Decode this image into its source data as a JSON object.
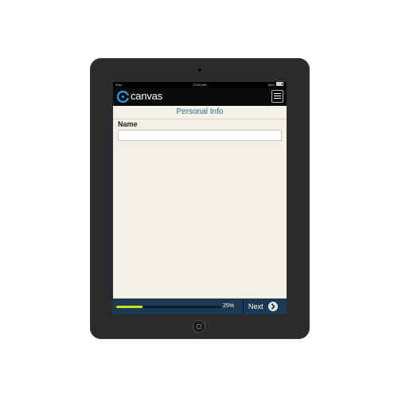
{
  "status_bar": {
    "carrier": "iPad",
    "time": "10:00 AM",
    "battery": "86%"
  },
  "app_bar": {
    "brand": "canvas",
    "logo_icon": "canvas-logo-icon",
    "menu_icon": "hamburger-menu-icon"
  },
  "page": {
    "title": "Personal Info"
  },
  "form": {
    "name_label": "Name",
    "name_value": "",
    "name_placeholder": ""
  },
  "footer": {
    "progress_percent": 25,
    "progress_text": "25%",
    "next_label": "Next",
    "next_icon": "chevron-right-circle-icon"
  },
  "colors": {
    "title_blue": "#2f6f9b",
    "footer_bg": "#1b3a52",
    "progress_fill": "#c8e000",
    "screen_bg": "#f5f0e6"
  }
}
